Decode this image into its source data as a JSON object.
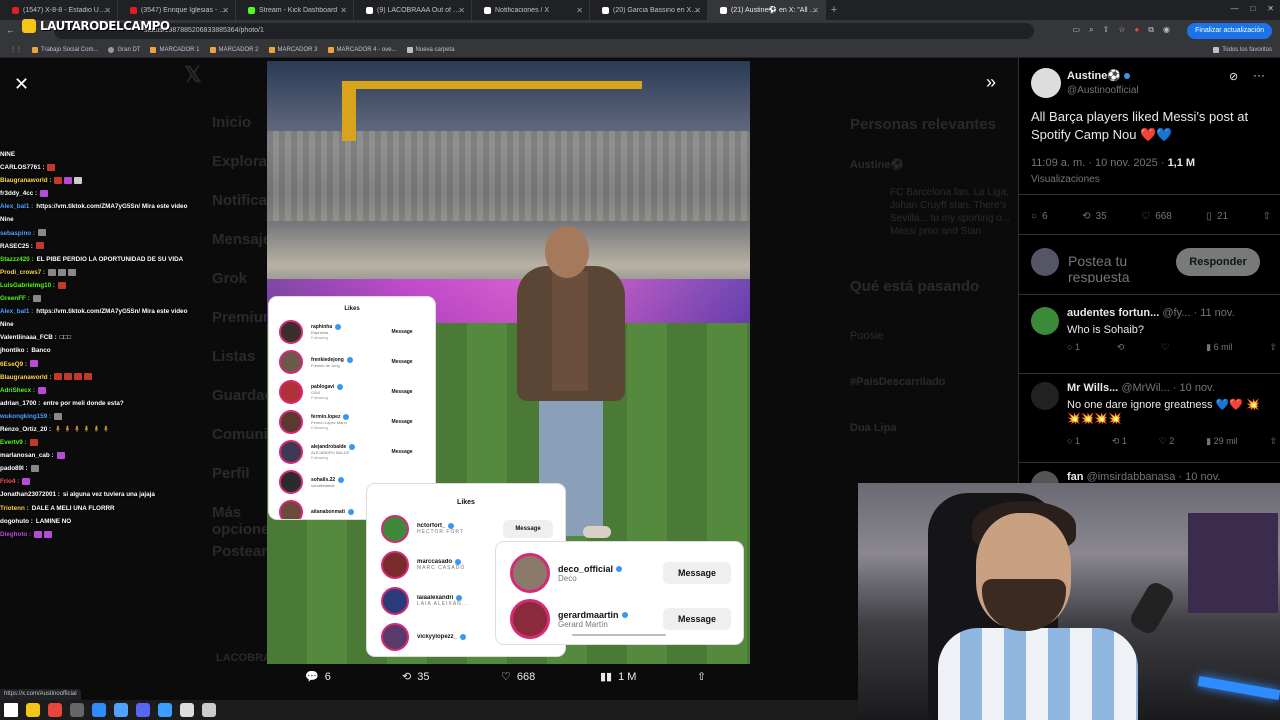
{
  "browser": {
    "tabs": [
      {
        "label": "(1547) X-8-8 - Estadio Único de...",
        "color": "#e02020"
      },
      {
        "label": "(3547) Enrique Iglesias - El Perd...",
        "color": "#e02020"
      },
      {
        "label": "Stream - Kick Dashboard",
        "color": "#53fc18"
      },
      {
        "label": "(9) LACOBRAAA Out of Conte...",
        "color": "#ffffff"
      },
      {
        "label": "Notificaciones / X",
        "color": "#ffffff"
      },
      {
        "label": "(20) Garcia Bassino en X: \"Cuan...",
        "color": "#ffffff"
      },
      {
        "label": "(21) Austine⚽ en X: \"All Barç...",
        "color": "#ffffff"
      }
    ],
    "url": "status/1987885206833885364/photo/1",
    "update_button": "Finalizar actualización",
    "bookmarks": [
      "Trabajo Social Com...",
      "Gran DT",
      "MARCADOR 1",
      "MARCADOR 2",
      "MARCADOR 3",
      "MARCADOR 4 - ove...",
      "Nueva carpeta"
    ],
    "all_bookmarks": "Todos los favoritos",
    "status_url": "https://x.com/Austinoofficial"
  },
  "stream": {
    "channel_name": "LAUTARODELCAMPO"
  },
  "background_sidebar": {
    "items": [
      "Inicio",
      "Explorar",
      "Notificaciones",
      "Mensajes",
      "Grok",
      "Premium",
      "Listas",
      "Guardados",
      "Comunidades",
      "Perfil",
      "Más opciones",
      "Postear"
    ],
    "right_titles": [
      "Personas relevantes",
      "Qué está pasando",
      "Poosie",
      "#PaísDescarrilado",
      "Dua Lipa"
    ],
    "profile_name": "Austine⚽",
    "profile_bio": "FC Barcelona fan. La Liga, Johan Cruyff stan. There's Sevilla... to my sporting o... Messi pmo and Stan",
    "bottom_user": "LACOBRA"
  },
  "photo_actions": {
    "replies": "6",
    "reposts": "35",
    "likes": "668",
    "views": "1 M"
  },
  "likes_card_1": {
    "title": "Likes",
    "rows": [
      {
        "user": "raphinha",
        "name": "Raphinha",
        "status": "Following",
        "btn": "Message",
        "av": "#3a2f2a"
      },
      {
        "user": "frenkiedejong",
        "name": "Frenkie de Jong",
        "status": "",
        "btn": "Message",
        "av": "#6b5a4a"
      },
      {
        "user": "pablogavi",
        "name": "GAVI",
        "status": "Following",
        "btn": "Message",
        "av": "#b0313a"
      },
      {
        "user": "fermin.lopez",
        "name": "Fermín López Marín",
        "status": "Following",
        "btn": "Message",
        "av": "#5a3a2e"
      },
      {
        "user": "alejandrobalde",
        "name": "ALEJANDRO BALDE",
        "status": "Following",
        "btn": "Message",
        "av": "#3e3a55"
      },
      {
        "user": "sohails.22",
        "name": "sohailbhattak",
        "status": "",
        "btn": "",
        "av": "#2b2b2b"
      },
      {
        "user": "aitanabonmati",
        "name": "",
        "status": "",
        "btn": "",
        "av": "#6a4a3a"
      }
    ]
  },
  "likes_card_2": {
    "title": "Likes",
    "rows": [
      {
        "user": "hctorfort_",
        "name": "HECTOR FORT",
        "btn": "Message",
        "av": "#3f8a3a"
      },
      {
        "user": "marccasado",
        "name": "MARC CASADÓ",
        "btn": "",
        "av": "#7a2a2a"
      },
      {
        "user": "laiaalexandri",
        "name": "LAIA ALEIXAN...",
        "btn": "",
        "av": "#2a3a7a"
      },
      {
        "user": "vickyylopezz_",
        "name": "",
        "btn": "",
        "av": "#5a3a6a"
      }
    ]
  },
  "likes_card_3": {
    "rows": [
      {
        "user": "deco_official",
        "name": "Deco",
        "btn": "Message",
        "av": "#8a7a6a"
      },
      {
        "user": "gerardmaartin",
        "name": "Gerard Martín",
        "btn": "Message",
        "av": "#8a2a3a"
      }
    ]
  },
  "tweet": {
    "author_name": "Austine⚽",
    "author_handle": "@Austinoofficial",
    "text": "All Barça players liked Messi's post at Spotify Camp Nou ❤️💙",
    "time": "11:09 a. m. · 10 nov. 2025 · ",
    "views_count": "1,1 M",
    "views_label": "Visualizaciones",
    "replies": "6",
    "reposts": "35",
    "likes": "668",
    "bookmarks": "21",
    "reply_placeholder": "Postea tu respuesta",
    "reply_button": "Responder"
  },
  "replies": [
    {
      "name": "audentes fortun...",
      "handle": "@fy...",
      "date": "· 11 nov.",
      "text": "Who is Sohaib?",
      "replies": "1",
      "reposts": "",
      "likes": "",
      "views": "6 mil",
      "av": "#3a8a3a"
    },
    {
      "name": "Mr Wills...",
      "handle": "@MrWil...",
      "date": "· 10 nov.",
      "text": "No one dare ignore greatness 💙❤️ 💥💥💥💥💥",
      "replies": "1",
      "reposts": "1",
      "likes": "2",
      "views": "29 mil",
      "av": "#222222"
    },
    {
      "name": "fan",
      "handle": "@imsirdabbanasa",
      "date": "· 10 nov.",
      "text": "",
      "replies": "",
      "reposts": "",
      "likes": "",
      "views": "",
      "av": "#555555"
    }
  ],
  "chat": [
    {
      "user": "",
      "msg": "NINE",
      "color": "#ffffff"
    },
    {
      "user": "CARLOS7761 :",
      "msg": "",
      "color": "#ffffff",
      "emotes": [
        "#c0392b"
      ]
    },
    {
      "user": "Blaugranaworld :",
      "msg": "",
      "color": "#ffd24d",
      "emotes": [
        "#c0392b",
        "#b84bd6",
        "#cccccc"
      ]
    },
    {
      "user": "fr3ddy_4cc :",
      "msg": "",
      "color": "#ffffff",
      "emotes": [
        "#b84bd6"
      ]
    },
    {
      "user": "Alex_bal1 :",
      "msg": "https://vm.tiktok.com/ZMA7yG5Sn/ Mira este video",
      "color": "#4da3ff"
    },
    {
      "user": "",
      "msg": "Nine",
      "color": "#ffffff"
    },
    {
      "user": "sebaspino :",
      "msg": "",
      "color": "#4da3ff",
      "emotes": [
        "#888888"
      ]
    },
    {
      "user": "RASEC25 :",
      "msg": "",
      "color": "#ffffff",
      "emotes": [
        "#c0392b"
      ]
    },
    {
      "user": "Stazzz420 :",
      "msg": "EL PIBE PERDIO LA OPORTUNIDAD DE SU VIDA",
      "color": "#53fc18"
    },
    {
      "user": "Prodi_crows7 :",
      "msg": "",
      "color": "#ffd24d",
      "emotes": [
        "#888888",
        "#888888",
        "#888888"
      ]
    },
    {
      "user": "LuisGabrielmg10 :",
      "msg": "",
      "color": "#53fc18",
      "emotes": [
        "#c0392b"
      ]
    },
    {
      "user": "GreenFF :",
      "msg": "",
      "color": "#53fc18",
      "emotes": [
        "#888888"
      ]
    },
    {
      "user": "Alex_bal1 :",
      "msg": "https://vm.tiktok.com/ZMA7yG5Sn/ Mira este video",
      "color": "#4da3ff"
    },
    {
      "user": "",
      "msg": "Nine",
      "color": "#ffffff"
    },
    {
      "user": "Valentiinaaa_FCB :",
      "msg": "□□□",
      "color": "#ffffff"
    },
    {
      "user": "jhontiko :",
      "msg": "Banco",
      "color": "#ffffff"
    },
    {
      "user": "6EseQ9 :",
      "msg": "",
      "color": "#ffd24d",
      "emotes": [
        "#b84bd6"
      ]
    },
    {
      "user": "Blaugranaworld :",
      "msg": "",
      "color": "#ffd24d",
      "emotes": [
        "#c0392b",
        "#c0392b",
        "#c0392b",
        "#c0392b"
      ]
    },
    {
      "user": "AdriShecx :",
      "msg": "",
      "color": "#53fc18",
      "emotes": [
        "#b84bd6"
      ]
    },
    {
      "user": "adrian_1700 :",
      "msg": "entre por meli donde esta?",
      "color": "#ffffff"
    },
    {
      "user": "wukongking159 :",
      "msg": "",
      "color": "#4da3ff",
      "emotes": [
        "#888888"
      ]
    },
    {
      "user": "Renzo_Ortiz_20 :",
      "msg": "🧍 🧍 🧍 🧍 🧍 🧍",
      "color": "#ffffff"
    },
    {
      "user": "Evertv9 :",
      "msg": "",
      "color": "#53fc18",
      "emotes": [
        "#c0392b"
      ]
    },
    {
      "user": "marlanosan_cab :",
      "msg": "",
      "color": "#ffffff",
      "emotes": [
        "#b84bd6"
      ]
    },
    {
      "user": "pado89l :",
      "msg": "",
      "color": "#ffffff",
      "emotes": [
        "#888888"
      ]
    },
    {
      "user": "Frio4 :",
      "msg": "",
      "color": "#ff5555",
      "emotes": [
        "#b84bd6"
      ]
    },
    {
      "user": "Jonathan23072001 :",
      "msg": "si alguna vez tuviera una jajaja",
      "color": "#ffffff"
    },
    {
      "user": "Triotenn :",
      "msg": "DALE A MELI UNA FLORRR",
      "color": "#ffd24d"
    },
    {
      "user": "dogohuto :",
      "msg": "LAMINE NO",
      "color": "#ffffff"
    },
    {
      "user": "Dieghoto :",
      "msg": "",
      "color": "#b84bd6",
      "emotes": [
        "#b84bd6",
        "#b84bd6"
      ]
    }
  ],
  "taskbar_icons": [
    "#ffffff",
    "#f5c518",
    "#e8453c",
    "#666666",
    "#2f8cff",
    "#4da3ff",
    "#5865f2",
    "#3aa0ff",
    "#dddddd",
    "#cccccc"
  ]
}
